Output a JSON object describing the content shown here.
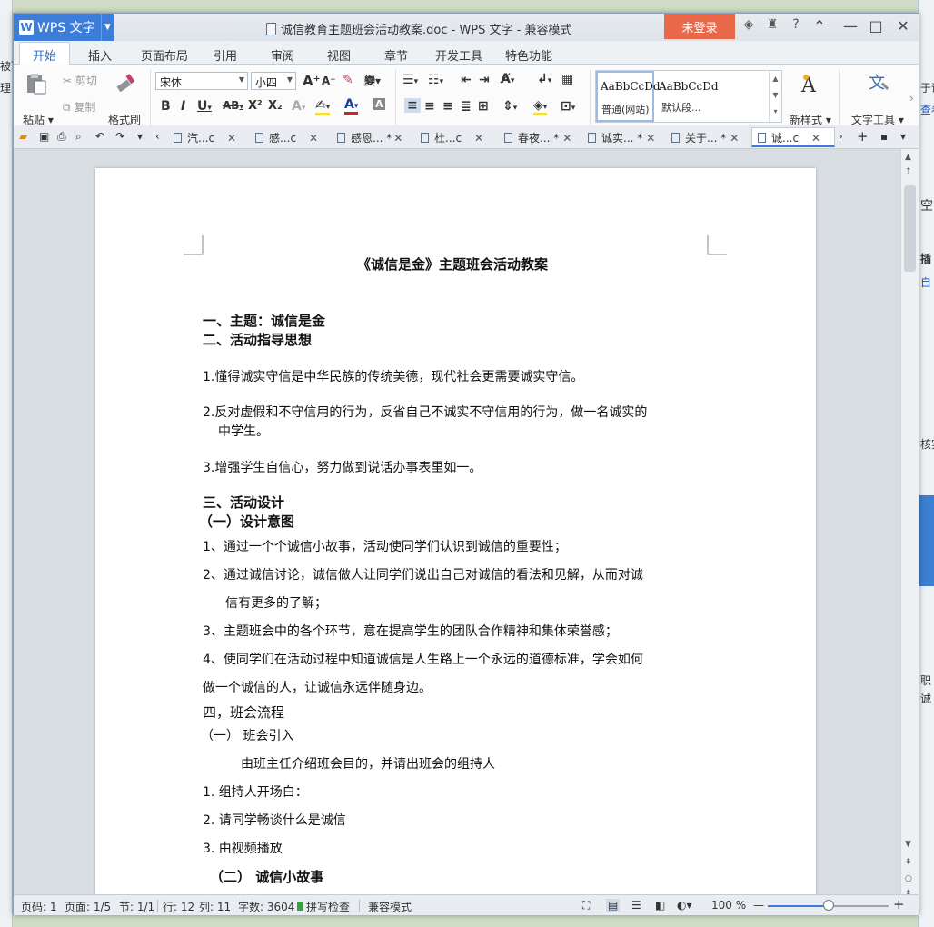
{
  "window": {
    "app_name": "WPS 文字",
    "title": "诚信教育主题班会活动教案.doc - WPS 文字 - 兼容模式",
    "login_label": "未登录"
  },
  "ribbon_tabs": [
    "开始",
    "插入",
    "页面布局",
    "引用",
    "审阅",
    "视图",
    "章节",
    "开发工具",
    "特色功能"
  ],
  "ribbon": {
    "paste": "粘贴",
    "cut": "剪切",
    "copy": "复制",
    "format_painter": "格式刷",
    "font_name": "宋体",
    "font_size": "小四",
    "style_normal_preview": "AaBbCcDd",
    "style_normal_name": "普通(网站)",
    "style_default_preview": "AaBbCcDd",
    "style_default_name": "默认段...",
    "new_style": "新样式",
    "text_tools": "文字工具"
  },
  "doc_tabs": [
    {
      "label": "汽...c",
      "active": false
    },
    {
      "label": "感...c",
      "active": false
    },
    {
      "label": "感恩... *",
      "active": false
    },
    {
      "label": "杜...c",
      "active": false
    },
    {
      "label": "春夜... *",
      "active": false
    },
    {
      "label": "诚实... *",
      "active": false
    },
    {
      "label": "关于... *",
      "active": false
    },
    {
      "label": "诚...c",
      "active": true
    }
  ],
  "document": {
    "title": "《诚信是金》主题班会活动教案",
    "h1": "一、主题：诚信是金",
    "h2": "二、活动指导思想",
    "p1": "1.懂得诚实守信是中华民族的传统美德，现代社会更需要诚实守信。",
    "p2a": "2.反对虚假和不守信用的行为，反省自己不诚实不守信用的行为，做一名诚实的",
    "p2b": "中学生。",
    "p3": "3.增强学生自信心，努力做到说话办事表里如一。",
    "h3": "三、活动设计",
    "h3a": "（一）设计意图",
    "d1": "1、通过一个个诚信小故事，活动使同学们认识到诚信的重要性；",
    "d2a": "2、通过诚信讨论，诚信做人让同学们说出自己对诚信的看法和见解，从而对诚",
    "d2b": "信有更多的了解；",
    "d3": "3、主题班会中的各个环节，意在提高学生的团队合作精神和集体荣誉感；",
    "d4a": "4、使同学们在活动过程中知道诚信是人生路上一个永远的道德标准，学会如何",
    "d4b": "做一个诚信的人，让诚信永远伴随身边。",
    "h4": "四，班会流程",
    "h4a": "（一）  班会引入",
    "i0": "由班主任介绍班会目的，并请出班会的组持人",
    "i1": "1. 组持人开场白：",
    "i2": "2. 请同学畅谈什么是诚信",
    "i3": "3. 由视频播放",
    "h4b": "（二）  诚信小故事"
  },
  "status": {
    "page_num": "页码: 1",
    "pages": "页面: 1/5",
    "section": "节: 1/1",
    "row": "行: 12",
    "col": "列: 11",
    "words": "字数: 3604",
    "spell": "拼写检查",
    "compat": "兼容模式",
    "zoom": "100 %",
    "zoom_value": 0.5
  },
  "background": {
    "frag_top_left": "被下",
    "frag_left": "理",
    "frag_right_1": "于诚",
    "frag_right_2": "查看",
    "frag_right_3": "空",
    "frag_right_4": "插",
    "frag_right_5": "自",
    "frag_right_6": "核实",
    "frag_right_7": "职",
    "frag_right_8": "诚"
  }
}
